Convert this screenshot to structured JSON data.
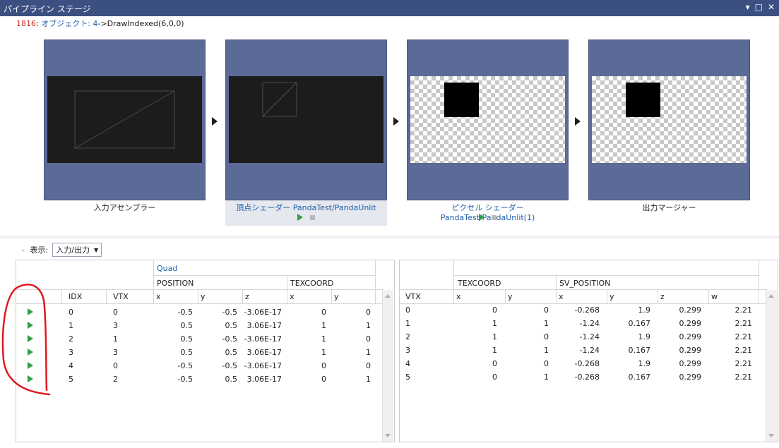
{
  "window": {
    "title": "パイプライン ステージ",
    "controls": [
      "▾",
      "□",
      "✕"
    ]
  },
  "breadcrumb": {
    "event_id": "1816",
    "separator": ":",
    "object_label": "オブジェクト: 4",
    "call": "->DrawIndexed(6,0,0)"
  },
  "stages": [
    {
      "label": "入力アセンブラー"
    },
    {
      "label": "頂点シェーダー PandaTest/PandaUnlit"
    },
    {
      "label": "ピクセル シェーダー PandaTest/PandaUnlit(1)"
    },
    {
      "label": "出力マージャー"
    }
  ],
  "view": {
    "label": "表示:",
    "selected": "入力/出力"
  },
  "input_table": {
    "group_header": "Quad",
    "headers_l2": [
      "POSITION",
      "TEXCOORD"
    ],
    "columns": [
      "IDX",
      "VTX",
      "x",
      "y",
      "z",
      "x",
      "y"
    ],
    "rows": [
      [
        "0",
        "0",
        "-0.5",
        "-0.5",
        "-3.06E-17",
        "0",
        "0"
      ],
      [
        "1",
        "3",
        "0.5",
        "0.5",
        "3.06E-17",
        "1",
        "1"
      ],
      [
        "2",
        "1",
        "0.5",
        "-0.5",
        "-3.06E-17",
        "1",
        "0"
      ],
      [
        "3",
        "3",
        "0.5",
        "0.5",
        "3.06E-17",
        "1",
        "1"
      ],
      [
        "4",
        "0",
        "-0.5",
        "-0.5",
        "-3.06E-17",
        "0",
        "0"
      ],
      [
        "5",
        "2",
        "-0.5",
        "0.5",
        "3.06E-17",
        "0",
        "1"
      ]
    ]
  },
  "output_table": {
    "headers_l2": [
      "TEXCOORD",
      "SV_POSITION"
    ],
    "columns": [
      "VTX",
      "x",
      "y",
      "x",
      "y",
      "z",
      "w"
    ],
    "rows": [
      [
        "0",
        "0",
        "0",
        "-0.268",
        "1.9",
        "0.299",
        "2.21"
      ],
      [
        "1",
        "1",
        "1",
        "-1.24",
        "0.167",
        "0.299",
        "2.21"
      ],
      [
        "2",
        "1",
        "0",
        "-1.24",
        "1.9",
        "0.299",
        "2.21"
      ],
      [
        "3",
        "1",
        "1",
        "-1.24",
        "0.167",
        "0.299",
        "2.21"
      ],
      [
        "4",
        "0",
        "0",
        "-0.268",
        "1.9",
        "0.299",
        "2.21"
      ],
      [
        "5",
        "0",
        "1",
        "-0.268",
        "0.167",
        "0.299",
        "2.21"
      ]
    ]
  },
  "colors": {
    "title_bar": "#3b4f81",
    "stage_bg": "#5b6a96",
    "link": "#1e5fa8",
    "play": "#2f9e44",
    "annotation": "#e0191e"
  }
}
